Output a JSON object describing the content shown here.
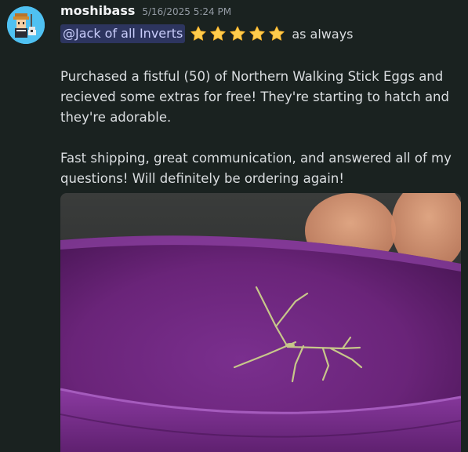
{
  "message": {
    "author": "moshibass",
    "timestamp": "5/16/2025 5:24 PM",
    "mention": "@Jack of all Inverts",
    "rating_stars": 5,
    "rating_icon": "star-emoji",
    "line1_suffix": "as always",
    "paragraphs": [
      "Purchased a fistful (50) of Northern Walking Stick Eggs and recieved some extras for free! They're starting to hatch and they're adorable.",
      "Fast shipping, great communication, and answered all of my questions! Will definitely be ordering again!"
    ]
  },
  "colors": {
    "background": "#1a2220",
    "username": "#f2f3f5",
    "timestamp": "#949ba4",
    "mention_text": "#c9cdfb",
    "star": "#ffcc4d",
    "avatar_bg": "#4fc1f2"
  }
}
